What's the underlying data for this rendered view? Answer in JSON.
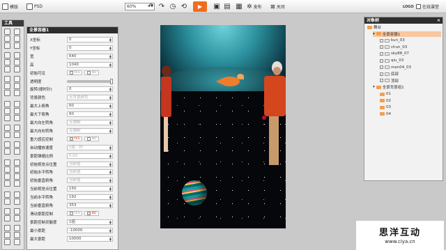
{
  "topbar": {
    "template_label": "模版",
    "psd_label": "PSD",
    "zoom_value": "60%",
    "publish_label": "发布",
    "close_label": "关闭",
    "logo_label": "LOGO",
    "online_course_label": "在线课堂"
  },
  "tools": {
    "title": "工具"
  },
  "props": {
    "title": "全景容器1",
    "rows": [
      {
        "label": "X坐标",
        "value": "0"
      },
      {
        "label": "Y坐标",
        "value": "0"
      },
      {
        "label": "宽",
        "value": "640"
      },
      {
        "label": "高",
        "value": "1040"
      },
      {
        "label": "初始可见",
        "yes": "YES",
        "no": "NO",
        "selected": "none"
      },
      {
        "label": "透明度",
        "slider": 1.0
      },
      {
        "label": "旋转(顺时针)",
        "value": "0"
      },
      {
        "label": "背景颜色",
        "value": "无背景颜色"
      },
      {
        "label": "最大上俯角",
        "value": "60"
      },
      {
        "label": "最大下俯角",
        "value": "60"
      },
      {
        "label": "最大向左转角",
        "value": "无限制"
      },
      {
        "label": "最大向右转角",
        "value": "无限制"
      },
      {
        "label": "重力感应控制",
        "yes": "YES",
        "no": "NO",
        "selected": "yes"
      },
      {
        "label": "自动播放速度",
        "value": "0度／秒"
      },
      {
        "label": "景距弹缩比例",
        "value": "0.02"
      },
      {
        "label": "初始视觉点位置",
        "value": "当前值"
      },
      {
        "label": "初始水平转角",
        "value": "当前值"
      },
      {
        "label": "初始垂直俯角",
        "value": "当前值"
      },
      {
        "label": "当前视觉点位置",
        "value": "150"
      },
      {
        "label": "当前水平转角",
        "value": "192"
      },
      {
        "label": "当前垂直俯角",
        "value": "353"
      },
      {
        "label": "滑动景距控制",
        "yes": "YES",
        "no": "NO",
        "selected": "no"
      },
      {
        "label": "景距控制灵敏度",
        "value": "1倍"
      },
      {
        "label": "最小景距",
        "value": "-10000"
      },
      {
        "label": "最大景距",
        "value": "10000"
      }
    ]
  },
  "scene": {
    "title": "对象树",
    "nodes": [
      {
        "label": "舞台",
        "depth": 0,
        "kind": "root"
      },
      {
        "label": "全景容器1",
        "depth": 1,
        "kind": "folder",
        "selected": true
      },
      {
        "label": "kun_03",
        "depth": 2,
        "kind": "layer"
      },
      {
        "label": "chun_03",
        "depth": 2,
        "kind": "layer"
      },
      {
        "label": "sky88_07",
        "depth": 2,
        "kind": "layer"
      },
      {
        "label": "qiu_03",
        "depth": 2,
        "kind": "layer"
      },
      {
        "label": "men04_03",
        "depth": 2,
        "kind": "layer"
      },
      {
        "label": "底部",
        "depth": 2,
        "kind": "layer"
      },
      {
        "label": "顶部",
        "depth": 2,
        "kind": "layer"
      },
      {
        "label": "全景背景组1",
        "depth": 1,
        "kind": "folder"
      },
      {
        "label": "01",
        "depth": 2,
        "kind": "folder"
      },
      {
        "label": "02",
        "depth": 2,
        "kind": "folder"
      },
      {
        "label": "03",
        "depth": 2,
        "kind": "folder"
      },
      {
        "label": "04",
        "depth": 2,
        "kind": "folder"
      }
    ]
  },
  "brand": {
    "name": "思洋互动",
    "url": "www.ciya.cn"
  },
  "colors": {
    "accent": "#f26b1d",
    "panel_header": "#2d2d2d",
    "selected_row": "#f9c7a0"
  }
}
